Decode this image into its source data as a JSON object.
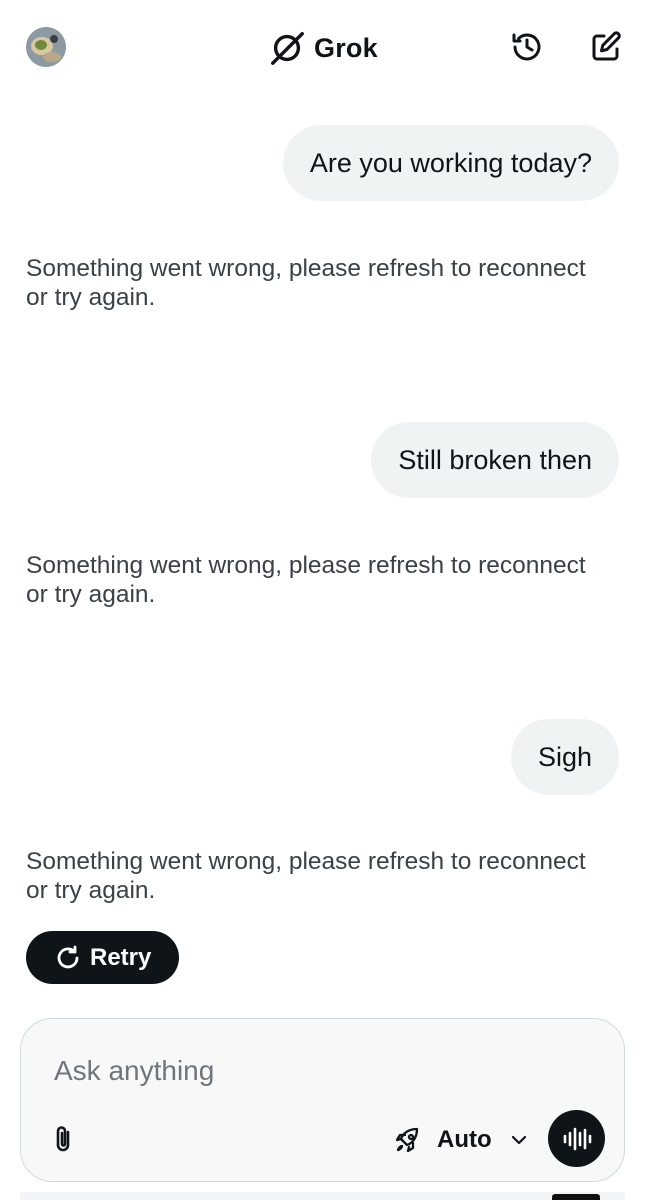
{
  "header": {
    "title": "Grok",
    "avatar_icon": "user-avatar",
    "brand_icon": "grok-logo-icon",
    "history_icon": "history-icon",
    "new_chat_icon": "compose-icon"
  },
  "messages": [
    {
      "role": "user",
      "text": "Are you working today?"
    },
    {
      "role": "assistant",
      "text": "Something went wrong, please refresh to reconnect or try again."
    },
    {
      "role": "user",
      "text": "Still broken then"
    },
    {
      "role": "assistant",
      "text": "Something went wrong, please refresh to reconnect or try again."
    },
    {
      "role": "user",
      "text": "Sigh"
    },
    {
      "role": "assistant",
      "text": "Something went wrong, please refresh to reconnect or try again."
    }
  ],
  "retry": {
    "label": "Retry",
    "icon": "refresh-icon"
  },
  "composer": {
    "placeholder": "Ask anything",
    "value": "",
    "attach_icon": "paperclip-icon",
    "mode_icon": "rocket-icon",
    "mode_label": "Auto",
    "mode_chevron_icon": "chevron-down-icon",
    "voice_icon": "voice-waveform-icon"
  },
  "colors": {
    "text_primary": "#0f1419",
    "text_bot": "#3a4148",
    "bubble_bg": "#eff3f4",
    "button_dark": "#0f1419",
    "composer_border": "#cfd9de",
    "placeholder": "#6f767b"
  }
}
